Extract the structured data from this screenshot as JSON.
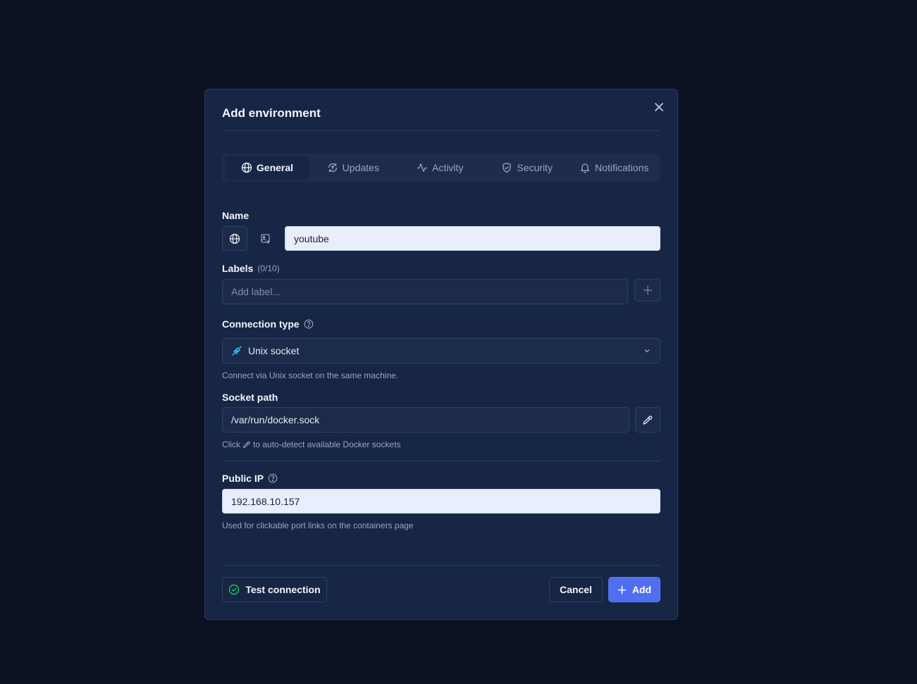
{
  "modal": {
    "title": "Add environment"
  },
  "tabs": [
    {
      "label": "General",
      "icon": "globe-icon",
      "active": true
    },
    {
      "label": "Updates",
      "icon": "refresh-upload-icon",
      "active": false
    },
    {
      "label": "Activity",
      "icon": "activity-icon",
      "active": false
    },
    {
      "label": "Security",
      "icon": "shield-check-icon",
      "active": false
    },
    {
      "label": "Notifications",
      "icon": "bell-icon",
      "active": false
    }
  ],
  "name_field": {
    "label": "Name",
    "value": "youtube"
  },
  "labels_field": {
    "label": "Labels",
    "count": "(0/10)",
    "placeholder": "Add label..."
  },
  "connection_type": {
    "label": "Connection type",
    "selected": "Unix socket",
    "help": "Connect via Unix socket on the same machine."
  },
  "socket_path": {
    "label": "Socket path",
    "value": "/var/run/docker.sock",
    "help_before": "Click",
    "help_after": "to auto-detect available Docker sockets"
  },
  "public_ip": {
    "label": "Public IP",
    "value": "192.168.10.157",
    "help": "Used for clickable port links on the containers page"
  },
  "footer": {
    "test_label": "Test connection",
    "cancel_label": "Cancel",
    "add_label": "Add"
  },
  "colors": {
    "background": "#0b1120",
    "modal": "#172645",
    "primary": "#4f6ff0",
    "success": "#22c55e",
    "socket_icon": "#38bdf8"
  }
}
